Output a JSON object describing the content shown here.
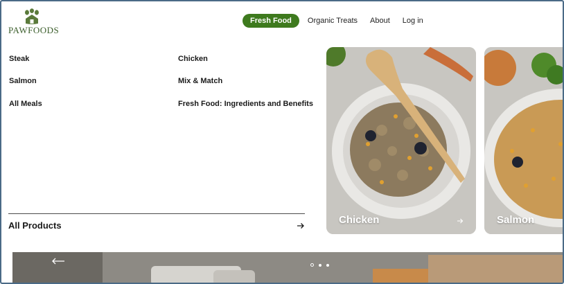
{
  "logo": {
    "text": "PAWFOODS",
    "icon": "paw-house-icon",
    "color": "#3b5e2b"
  },
  "nav": {
    "items": [
      {
        "label": "Fresh Food",
        "active": true
      },
      {
        "label": "Organic Treats",
        "active": false
      },
      {
        "label": "About",
        "active": false
      },
      {
        "label": "Log in",
        "active": false
      }
    ],
    "accent": "#3e7a1e"
  },
  "menu": {
    "left": [
      "Steak",
      "Salmon",
      "All Meals"
    ],
    "right": [
      "Chicken",
      "Mix & Match",
      "Fresh Food: Ingredients and Benefits"
    ]
  },
  "all_products": {
    "label": "All Products",
    "icon": "arrow-right-icon"
  },
  "cards": [
    {
      "label": "Chicken",
      "icon": "arrow-right-icon"
    },
    {
      "label": "Salmon"
    }
  ],
  "carousel": {
    "prev_icon": "arrow-left-icon",
    "dots": 3,
    "active_dot": 0
  }
}
